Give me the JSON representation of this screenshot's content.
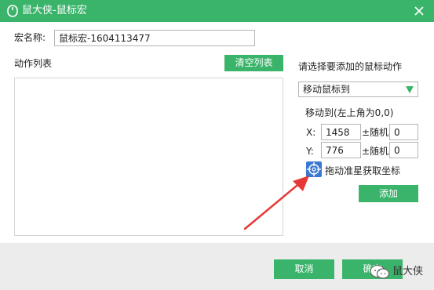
{
  "window": {
    "title": "鼠大侠-鼠标宏",
    "close_symbol": "✕"
  },
  "macro": {
    "name_label": "宏名称:",
    "name_value": "鼠标宏-1604113477"
  },
  "action_list": {
    "label": "动作列表",
    "clear_button": "清空列表",
    "items": []
  },
  "mouse_action": {
    "prompt": "请选择要添加的鼠标动作",
    "selected": "移动鼠标到",
    "move_to_label": "移动到(左上角为0,0)",
    "x_label": "X:",
    "x_value": "1458",
    "x_random_label": "±随机:",
    "x_random_value": "0",
    "y_label": "Y:",
    "y_value": "776",
    "y_random_label": "±随机:",
    "y_random_value": "0",
    "crosshair_label": "拖动准星获取坐标",
    "add_button": "添加"
  },
  "footer": {
    "cancel_button": "取消",
    "ok_button": "确定",
    "watermark": "鼠大侠"
  },
  "colors": {
    "accent_green": "#3bb46b",
    "crosshair_blue": "#3a78d4",
    "annotation_red": "#e53935",
    "footer_gray": "#ececec"
  },
  "icons": {
    "app_logo": "mouse-logo-icon",
    "close": "close-icon",
    "dropdown": "triangle-down-icon",
    "crosshair": "crosshair-icon",
    "wechat": "wechat-icon"
  }
}
